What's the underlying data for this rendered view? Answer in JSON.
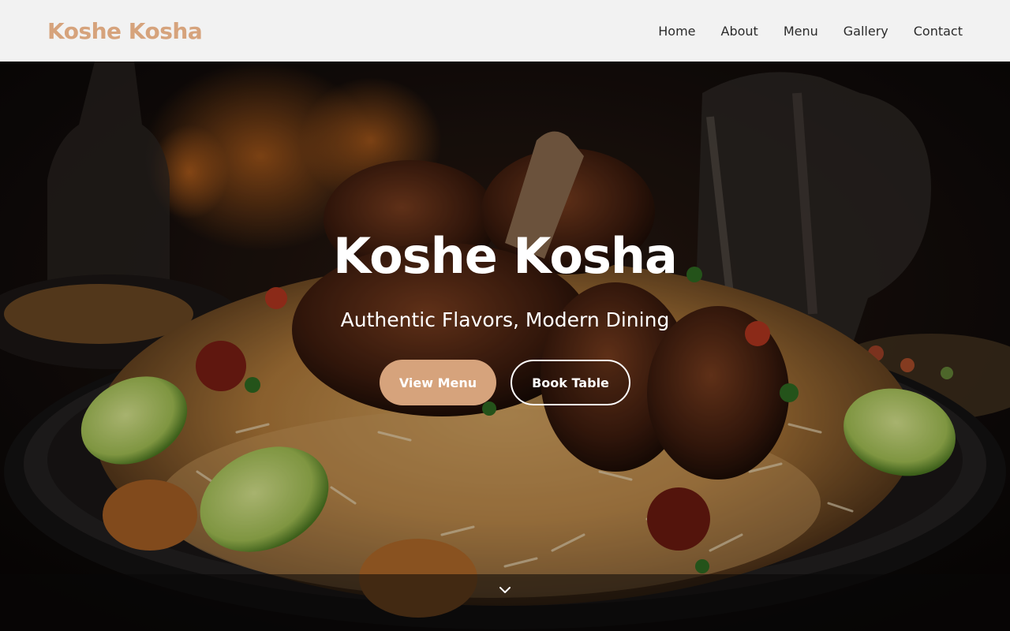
{
  "header": {
    "brand": "Koshe Kosha",
    "nav": [
      "Home",
      "About",
      "Menu",
      "Gallery",
      "Contact"
    ]
  },
  "hero": {
    "title": "Koshe Kosha",
    "subtitle": "Authentic Flavors, Modern Dining",
    "primary_button": "View Menu",
    "secondary_button": "Book Table",
    "scroll_icon": "chevron-down-icon"
  },
  "colors": {
    "brand": "#d6a37c",
    "header_bg": "#f2f2f2",
    "nav_text": "#2b2b2b",
    "hero_text": "#ffffff"
  }
}
